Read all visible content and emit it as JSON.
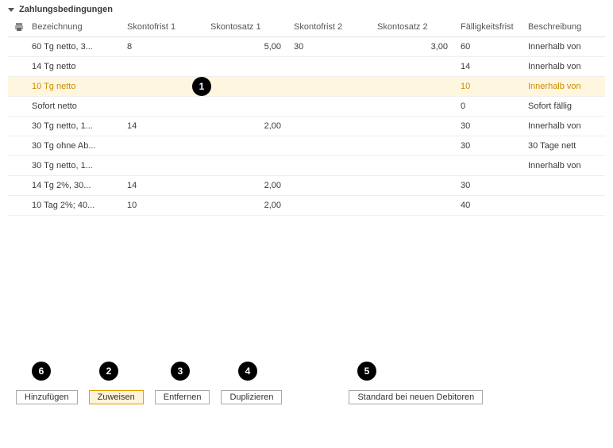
{
  "section_title": "Zahlungsbedingungen",
  "columns": {
    "designation": "Bezeichnung",
    "discountPeriod1": "Skontofrist 1",
    "discountRate1": "Skontosatz 1",
    "discountPeriod2": "Skontofrist 2",
    "discountRate2": "Skontosatz 2",
    "dueDate": "Fälligkeitsfrist",
    "description": "Beschreibung"
  },
  "rows": [
    {
      "designation": "60 Tg netto, 3...",
      "sf1": "8",
      "ss1": "5,00",
      "sf2": "30",
      "ss2": "3,00",
      "due": "60",
      "beschr": "Innerhalb von"
    },
    {
      "designation": "14 Tg netto",
      "sf1": "",
      "ss1": "",
      "sf2": "",
      "ss2": "",
      "due": "14",
      "beschr": "Innerhalb von"
    },
    {
      "designation": "10 Tg netto",
      "sf1": "",
      "ss1": "",
      "sf2": "",
      "ss2": "",
      "due": "10",
      "beschr": "Innerhalb von",
      "selected": true
    },
    {
      "designation": "Sofort netto",
      "sf1": "",
      "ss1": "",
      "sf2": "",
      "ss2": "",
      "due": "0",
      "beschr": "Sofort fällig"
    },
    {
      "designation": "30 Tg netto, 1...",
      "sf1": "14",
      "ss1": "2,00",
      "sf2": "",
      "ss2": "",
      "due": "30",
      "beschr": "Innerhalb von"
    },
    {
      "designation": "30 Tg ohne Ab...",
      "sf1": "",
      "ss1": "",
      "sf2": "",
      "ss2": "",
      "due": "30",
      "beschr": "30 Tage nett"
    },
    {
      "designation": "30 Tg netto, 1...",
      "sf1": "",
      "ss1": "",
      "sf2": "",
      "ss2": "",
      "due": "",
      "beschr": "Innerhalb von"
    },
    {
      "designation": "14 Tg  2%, 30...",
      "sf1": "14",
      "ss1": "2,00",
      "sf2": "",
      "ss2": "",
      "due": "30",
      "beschr": ""
    },
    {
      "designation": "10 Tag 2%; 40...",
      "sf1": "10",
      "ss1": "2,00",
      "sf2": "",
      "ss2": "",
      "due": "40",
      "beschr": ""
    }
  ],
  "buttons": {
    "add": {
      "label": "Hinzufügen",
      "primary": false
    },
    "assign": {
      "label": "Zuweisen",
      "primary": true
    },
    "remove": {
      "label": "Entfernen",
      "primary": false
    },
    "duplicate": {
      "label": "Duplizieren",
      "primary": false
    },
    "newDebtorDefault": {
      "label": "Standard bei neuen Debitoren",
      "primary": false
    }
  },
  "callouts": {
    "row": {
      "text": "1"
    },
    "btn_add": {
      "text": "6"
    },
    "btn_assign": {
      "text": "2"
    },
    "btn_remove": {
      "text": "3"
    },
    "btn_dup": {
      "text": "4"
    },
    "btn_newdef": {
      "text": "5"
    }
  }
}
